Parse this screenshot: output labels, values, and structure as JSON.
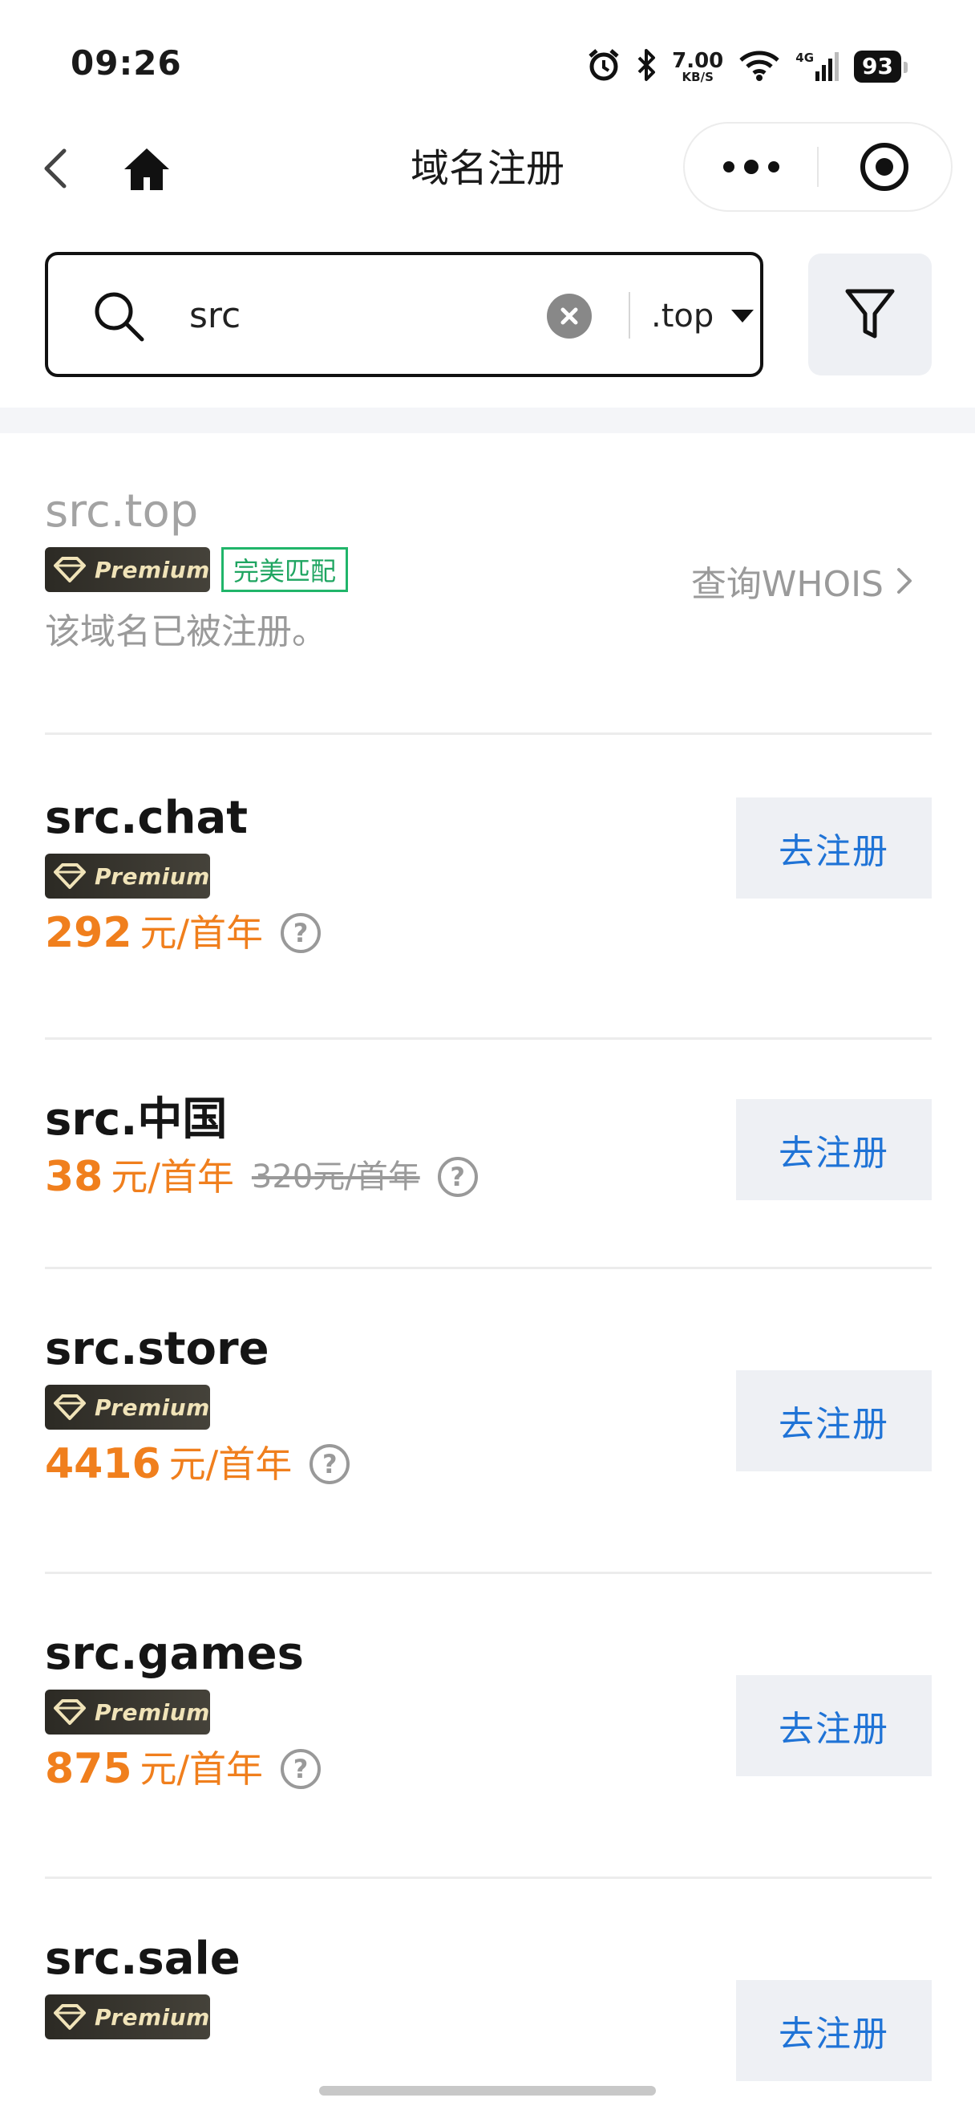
{
  "status_bar": {
    "time": "09:26",
    "net_speed_value": "7.00",
    "net_speed_unit": "KB/S",
    "network": "4G",
    "battery": "93"
  },
  "nav": {
    "title": "域名注册"
  },
  "search": {
    "query": "src",
    "tld": ".top"
  },
  "results": [
    {
      "domain": "src.top",
      "premium_label": "Premium",
      "match_label": "完美匹配",
      "whois_label": "查询WHOIS",
      "status": "该域名已被注册。"
    },
    {
      "domain": "src.chat",
      "premium_label": "Premium",
      "price": "292",
      "unit": "元/首年",
      "button": "去注册"
    },
    {
      "domain": "src.中国",
      "price": "38",
      "unit": "元/首年",
      "original_price": "320元/首年",
      "button": "去注册"
    },
    {
      "domain": "src.store",
      "premium_label": "Premium",
      "price": "4416",
      "unit": "元/首年",
      "button": "去注册"
    },
    {
      "domain": "src.games",
      "premium_label": "Premium",
      "price": "875",
      "unit": "元/首年",
      "button": "去注册"
    },
    {
      "domain": "src.sale",
      "premium_label": "Premium",
      "button": "去注册"
    }
  ],
  "colors": {
    "price": "#f07f1d",
    "button_text": "#1f73d6",
    "match_green": "#1fa561"
  }
}
